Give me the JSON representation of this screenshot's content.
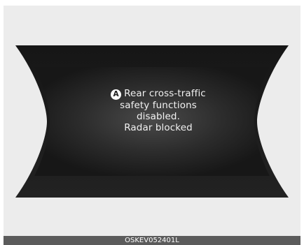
{
  "display": {
    "badge": "A",
    "message_lines": [
      "Rear cross-traffic",
      "safety functions",
      "disabled.",
      "Radar blocked"
    ]
  },
  "footer": {
    "code": "OSKEV052401L"
  },
  "colors": {
    "panel_background": "#ececec",
    "display_background": "#1b1b1b",
    "text": "#f2f2f2",
    "footer_bar": "#5b5b5b"
  }
}
